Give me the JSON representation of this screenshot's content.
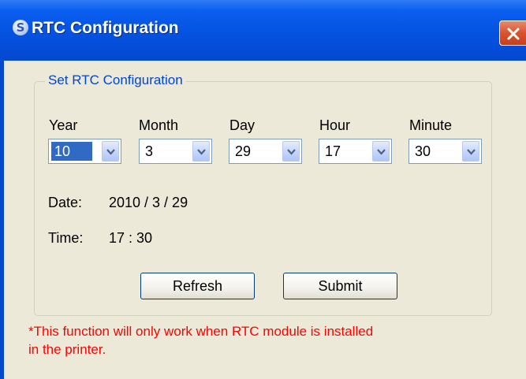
{
  "window": {
    "title": "RTC Configuration",
    "icon": "app-logo-icon",
    "close_icon": "close-icon",
    "close_color": "#d9532f"
  },
  "group": {
    "legend": "Set RTC Configuration"
  },
  "fields": [
    {
      "label": "Year",
      "value": "10"
    },
    {
      "label": "Month",
      "value": "3"
    },
    {
      "label": "Day",
      "value": "29"
    },
    {
      "label": "Hour",
      "value": "17"
    },
    {
      "label": "Minute",
      "value": "30"
    }
  ],
  "date": {
    "label": "Date:",
    "value": "2010 / 3 / 29"
  },
  "time": {
    "label": "Time:",
    "value": "17 : 30"
  },
  "buttons": {
    "refresh": "Refresh",
    "submit": "Submit"
  },
  "note": {
    "line1": "*This function will only work when RTC module is installed",
    "line2": "in the printer.",
    "color": "#ff0000"
  },
  "colors": {
    "titlebar": "#0552e0",
    "legend": "#0046d5",
    "selection": "#316ac5",
    "client_bg": "#ece9d8"
  }
}
